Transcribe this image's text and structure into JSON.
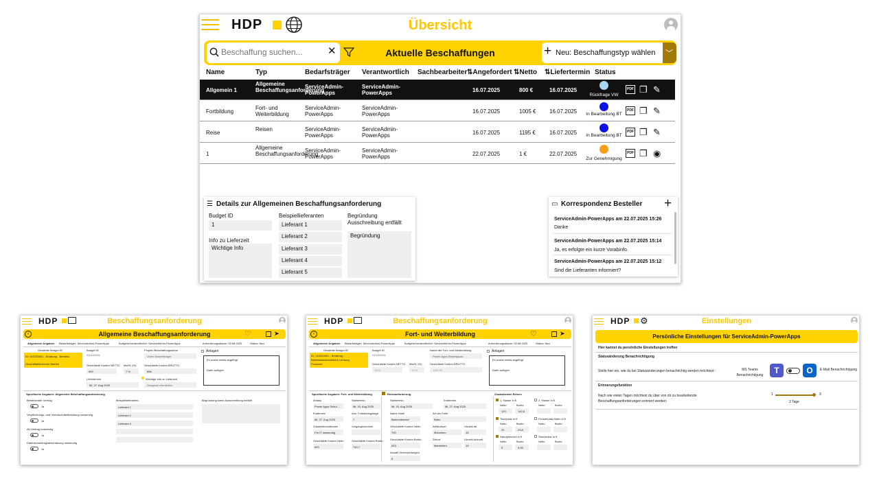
{
  "main": {
    "logo": "HDP",
    "title": "Übersicht",
    "search_placeholder": "Beschaffung suchen...",
    "bar_title": "Aktuelle Beschaffungen",
    "new_button": "Neu: Beschaffungstyp wählen",
    "columns": [
      "Name",
      "Typ",
      "Bedarfsträger",
      "Verantwortlich",
      "Sachbearbeiter",
      "Angefordert",
      "Netto",
      "Liefertermin",
      "Status"
    ],
    "rows": [
      {
        "name": "Allgemein 1",
        "typ": "Allgemeine Beschaffungsanforderung",
        "bedarf": "ServiceAdmin-PowerApps",
        "verant": "ServiceAdmin-PowerApps",
        "datum": "16.07.2025",
        "netto": "800 €",
        "liefer": "16.07.2025",
        "status": "Rückfrage VW",
        "color": "#a8d8ef"
      },
      {
        "name": "Fortbildung",
        "typ": "Fort- und Weiterbildung",
        "bedarf": "ServiceAdmin-PowerApps",
        "verant": "ServiceAdmin-PowerApps",
        "datum": "16.07.2025",
        "netto": "1005 €",
        "liefer": "16.07.2025",
        "status": "In Bearbeitung BT",
        "color": "#0a12e6"
      },
      {
        "name": "Reise",
        "typ": "Reisen",
        "bedarf": "ServiceAdmin-PowerApps",
        "verant": "ServiceAdmin-PowerApps",
        "datum": "16.07.2025",
        "netto": "1195 €",
        "liefer": "16.07.2025",
        "status": "In Bearbeitung BT",
        "color": "#0a12e6"
      },
      {
        "name": "1",
        "typ": "Allgemeine Beschaffungsanforderung",
        "bedarf": "ServiceAdmin-PowerApps",
        "verant": "ServiceAdmin-PowerApps",
        "datum": "22.07.2025",
        "netto": "1 €",
        "liefer": "22.07.2025",
        "status": "Zur Genehmigung",
        "color": "#f6a01a"
      }
    ],
    "details": {
      "title": "Details zur Allgemeinen Beschaffungsanforderung",
      "budget_label": "Budget ID",
      "budget_value": "1",
      "lieferzeit_label": "Info zu Lieferzeit",
      "lieferzeit_value": "Wichtige Info",
      "lieferanten_label": "Beispiellieferanten",
      "lieferanten": [
        "Lieferant 1",
        "Lieferant 2",
        "Lieferant 3",
        "Lieferant 4",
        "Lieferant 5"
      ],
      "begr_label": "Begründung Ausschreibung entfällt",
      "begr_value": "Begründung"
    },
    "corr": {
      "title": "Korrespondenz Besteller",
      "messages": [
        {
          "head": "ServiceAdmin-PowerApps am 22.07.2025 15:26",
          "text": "Danke"
        },
        {
          "head": "ServiceAdmin-PowerApps am 22.07.2025 15:14",
          "text": "Ja, es erfolgte ein kurze Vorabinfo."
        },
        {
          "head": "ServiceAdmin-PowerApps am 22.07.2025 15:12",
          "text": "Sind die Lieferanten informiert?"
        }
      ]
    }
  },
  "w1": {
    "title": "Beschaffungsanforderung",
    "bar_title": "Allgemeine Beschaffungsanforderung",
    "tabs": [
      "Allgemeine Angaben",
      "Bedarfsträger: ServiceAdmin-PowerApps",
      "Budgetverantwortlicher: ServiceAdmin-PowerApps",
      "Anforderungsdatum: 20.08.2025",
      "Status: Neu"
    ],
    "budget_header": "Gewählte Budget ID",
    "budget_sel": "ID: 010100001 - Beratung - Betriebs",
    "budget_sel2": "Geschäftsführender Betrieb",
    "f_budgetid": "Budget ID",
    "v_budgetid": "010100001",
    "f_projekt": "Projekt-/Beschaffungsname",
    "v_projekt": "Video Bedarfsträger",
    "f_netto": "Geschätzte Kosten NETTO",
    "v_netto": "800",
    "f_mwst": "MwSt. (%)",
    "v_mwst": "7 %",
    "f_brutto": "Geschätzte Kosten BRUTTO",
    "v_brutto": "856",
    "f_liefer": "Liefertermin",
    "v_liefer": "Mi, 27. Aug 2025",
    "f_wichtig": "Wichtige Info zu Lieferzeit",
    "v_wichtig": "Dringend erforderlich",
    "anlagen": "Anlagen",
    "nofiles": "Es wurde nichts angefügt.",
    "attach": "Datei anfügen",
    "spec": "Spezifische Angaben: Allgemeine Beschaffungsanforderung",
    "checks": [
      "Bestehender Vertrag",
      "Verpflichtungs- und Verbrauchtfeiterklärung notwendig",
      "AV-Vertrag notwendig",
      "Datenschutzfolgeabschätzung notwendig"
    ],
    "ja": "Ja",
    "beisp": "Beispiellieferanten",
    "lief": [
      "Lieferant 1",
      "Lieferant 2",
      "Lieferant 3"
    ],
    "begr": "Begründung wenn Ausschreibung entfällt"
  },
  "w2": {
    "title": "Beschaffungsanforderung",
    "bar_title": "Fort- und Weiterbildung",
    "tabs": [
      "Allgemeine Angaben",
      "Bedarfsträger: ServiceAdmin-PowerApps",
      "Budgetverantwortlicher: ServiceAdmin-PowerApps",
      "Anforderungsdatum: 20.08.2025",
      "Status: Neu"
    ],
    "budget_header": "Gewählte Budget ID",
    "budget_sel": "ID: 010200001 - Beratung -",
    "budget_sel2": "Betriebswirtschaftliche Lehrung",
    "budget_sel3": "Finanzen",
    "f_budgetid": "Budget ID",
    "v_budgetid": "010200001",
    "f_name": "Name der Fort- und Weiterbildung",
    "v_name": "Power Apps Einsteigkurs",
    "f_netto": "Geschätzte Kosten NETTO",
    "v_netto": "1005",
    "f_mwst": "MwSt. (%)",
    "v_mwst": "19 %",
    "f_brutto": "Geschätzte Kosten BRUTTO",
    "v_brutto": "1195,95",
    "anlagen": "Anlagen",
    "nofiles": "Es wurde nichts angefügt.",
    "attach": "Datei anfügen",
    "spec": "Spezifische Angaben: Fort- und Weiterbildung",
    "reise": "Reiseanforderung",
    "zus": "Zusatzkosten Reisen",
    "anlass": "Anlass",
    "v_anlass": "Power Apps Schul...",
    "starttermin": "Starttermin",
    "v_start": "Mi, 20. Aug 2025",
    "endtermin": "Endtermin",
    "v_end": "Mi, 27. Aug 2025",
    "anz": "Anz. Fortbildungstage",
    "v_anz": "7",
    "zusinfo": "Zusatzinformationen",
    "v_zusinfo": "Für IT notwendig",
    "vorgang": "Vorgangsnummer",
    "gkn": "Geschätzte Kosten Netto",
    "v_gkn": "620",
    "gkb": "Geschätzte Kosten Brutto",
    "v_gkb": "740,7",
    "r_start": "Starttermin",
    "r_vstart": "Mi, 20. Aug 2025",
    "r_end": "Endtermin",
    "r_vend": "Mi, 27. Aug 2025",
    "hotel": "Name Hotel",
    "v_hotel": "Bahnhofshotel",
    "art": "Art der Fahrt",
    "v_art": "Bahn",
    "hn": "Geschätzte Kosten Netto",
    "v_hn": "700",
    "ab": "Abfahrtsort",
    "v_ab": "Münchem",
    "uab": "Uhrzeit ab",
    "v_uab": "15",
    "hb": "Geschätzte Kosten Brutto",
    "v_hb": "833",
    "ziel": "Zielort",
    "v_ziel": "Mannheim",
    "uan": "Uhrzeit Ankunft",
    "v_uan": "19",
    "ueb": "Anzahl Übernachtungen",
    "v_ueb": "6",
    "k1": "1. Klasse in €",
    "k2": "2. Klasse in €",
    "tp": "Tischplatz in €",
    "fp": "Fensterplatz Bahn in €",
    "hd": "Handybereich in €",
    "st": "Stornierbar in €",
    "netto": "Netto",
    "brutto": "Brutto",
    "v_k1n": "120",
    "v_k1b": "142,8",
    "v_tpn": "20",
    "v_tpb": "23,8",
    "v_hdn": "5",
    "v_hdb": "5,95"
  },
  "w3": {
    "title": "Einstellungen",
    "bar_title": "Persönliche Einstellungen für ServiceAdmin-PowerApps",
    "intro": "Hier kannst du persönliche Einstellungen treffen",
    "sec1": "Statusänderung Benachrichtigung",
    "q1": "Stelle hier ein, wie du bei Statusänderungen benachrichtig werden möchtest:",
    "teams": "MS Teams Benachrichtigung",
    "mail": "E-Mail Benachrichtigung",
    "sec2": "Erinnerungsfunktion",
    "q2": "Nach wie vielen Tagen möchtest du über von dir zu bearbeitende Beschaffungsanforderungen erinnert werden:",
    "s_min": "1",
    "s_max": "3",
    "s_val": "3 Tage",
    "s_fraction": 1.0
  }
}
